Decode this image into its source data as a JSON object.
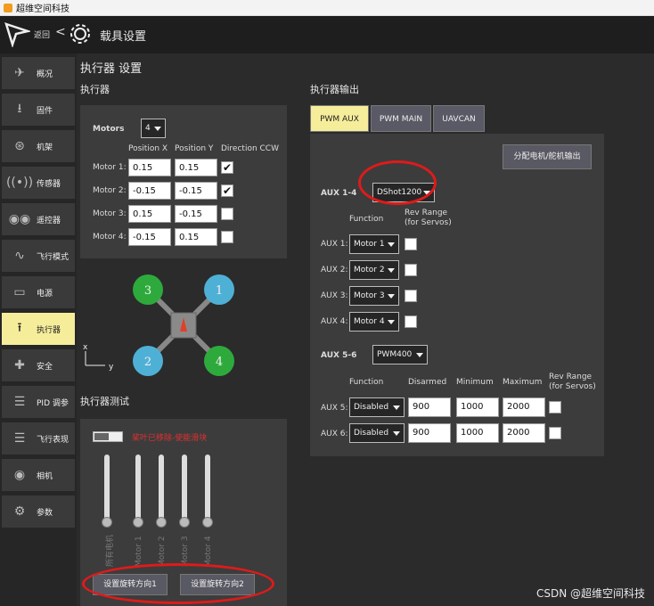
{
  "window": {
    "title": "超维空间科技"
  },
  "toolbar": {
    "back_label": "返回",
    "back_arrow": "<",
    "page_title": "载具设置"
  },
  "sidebar": {
    "items": [
      {
        "label": "概况",
        "icon": "plane-icon"
      },
      {
        "label": "固件",
        "icon": "download-icon"
      },
      {
        "label": "机架",
        "icon": "airframe-icon"
      },
      {
        "label": "传感器",
        "icon": "radio-signal-icon"
      },
      {
        "label": "遥控器",
        "icon": "gamepad-icon"
      },
      {
        "label": "飞行模式",
        "icon": "wave-icon"
      },
      {
        "label": "电源",
        "icon": "battery-icon"
      },
      {
        "label": "执行器",
        "icon": "upload-icon",
        "active": true
      },
      {
        "label": "安全",
        "icon": "medkit-icon"
      },
      {
        "label": "PID 调参",
        "icon": "sliders-icon"
      },
      {
        "label": "飞行表现",
        "icon": "sliders-icon"
      },
      {
        "label": "相机",
        "icon": "camera-icon"
      },
      {
        "label": "参数",
        "icon": "gears-icon"
      }
    ]
  },
  "main": {
    "title": "执行器 设置",
    "geometry_section": "执行器",
    "motors_label": "Motors",
    "motors_count": "4",
    "col_headers": {
      "pos_x": "Position X",
      "pos_y": "Position Y",
      "ccw": "Direction CCW"
    },
    "motors": [
      {
        "label": "Motor 1:",
        "x": "0.15",
        "y": "0.15",
        "ccw": true
      },
      {
        "label": "Motor 2:",
        "x": "-0.15",
        "y": "-0.15",
        "ccw": true
      },
      {
        "label": "Motor 3:",
        "x": "0.15",
        "y": "-0.15",
        "ccw": false
      },
      {
        "label": "Motor 4:",
        "x": "-0.15",
        "y": "0.15",
        "ccw": false
      }
    ],
    "diagram": {
      "m1": "1",
      "m2": "2",
      "m3": "3",
      "m4": "4",
      "axis_x": "x",
      "axis_y": "y"
    },
    "test_section": "执行器测试",
    "test_warning": "桨叶已移除-使能滑块",
    "slider_labels": [
      "所有电机",
      "Motor 1",
      "Motor 2",
      "Motor 3",
      "Motor 4"
    ],
    "spin_btn1": "设置旋转方向1",
    "spin_btn2": "设置旋转方向2"
  },
  "outputs": {
    "section": "执行器输出",
    "tabs": [
      "PWM AUX",
      "PWM MAIN",
      "UAVCAN"
    ],
    "assign_btn": "分配电机/舵机输出",
    "aux14_label": "AUX 1-4",
    "aux14_protocol": "DShot1200",
    "function_hdr": "Function",
    "rev_hdr": "Rev Range\n(for Servos)",
    "aux14": [
      {
        "label": "AUX 1:",
        "func": "Motor 1"
      },
      {
        "label": "AUX 2:",
        "func": "Motor 2"
      },
      {
        "label": "AUX 3:",
        "func": "Motor 3"
      },
      {
        "label": "AUX 4:",
        "func": "Motor 4"
      }
    ],
    "aux56_label": "AUX 5-6",
    "aux56_protocol": "PWM400",
    "hdr_disarmed": "Disarmed",
    "hdr_min": "Minimum",
    "hdr_max": "Maximum",
    "aux56": [
      {
        "label": "AUX 5:",
        "func": "Disabled",
        "disarmed": "900",
        "min": "1000",
        "max": "2000"
      },
      {
        "label": "AUX 6:",
        "func": "Disabled",
        "disarmed": "900",
        "min": "1000",
        "max": "2000"
      }
    ]
  },
  "watermark": "CSDN @超维空间科技",
  "colors": {
    "active": "#f6ed9b",
    "motor_cw": "#2eaa3c",
    "motor_ccw": "#4fb0d6",
    "annotation": "#e01a1a"
  }
}
